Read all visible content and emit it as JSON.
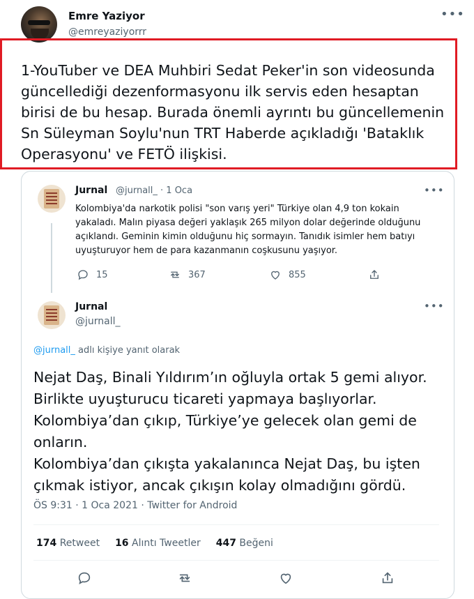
{
  "author": {
    "name": "Emre Yaziyor",
    "handle": "@emreyaziyorrr"
  },
  "tweet_text": "1-YouTuber ve DEA Muhbiri Sedat Peker'in son videosunda güncellediği dezenformasyonu ilk servis eden hesaptan birisi de bu hesap. Burada önemli ayrıntı bu güncellemenin Sn Süleyman Soylu'nun TRT Haberde açıkladığı 'Bataklık Operasyonu' ve FETÖ ilişkisi.",
  "quote_first": {
    "name": "Jurnal",
    "meta": "@jurnall_ · 1 Oca",
    "text": "Kolombiya'da narkotik polisi \"son varış yeri\" Türkiye olan 4,9 ton kokain yakaladı. Malın piyasa değeri yaklaşık 265 milyon dolar değerinde olduğunu açıklandı. Geminin kimin olduğunu hiç sormayın. Tanıdık isimler hem batıyı uyuşturuyor hem de para kazanmanın coşkusunu yaşıyor.",
    "replies": "15",
    "retweets": "367",
    "likes": "855"
  },
  "quote_second": {
    "name": "Jurnal",
    "handle": "@jurnall_",
    "reply_mention": "@jurnall_",
    "reply_suffix": "adlı kişiye yanıt olarak",
    "text_lines": [
      "Nejat Daş, Binali Yıldırım’ın oğluyla ortak 5 gemi alıyor.",
      "Birlikte uyuşturucu ticareti yapmaya başlıyorlar.",
      "Kolombiya’dan çıkıp, Türkiye’ye gelecek olan gemi de onların.",
      "Kolombiya’dan çıkışta yakalanınca Nejat Daş, bu işten çıkmak istiyor, ancak çıkışın kolay olmadığını gördü."
    ],
    "timestamp": "ÖS 9:31 · 1 Oca 2021 · Twitter for Android",
    "stats": {
      "retweet_count": "174",
      "retweet_label": "Retweet",
      "quote_count": "16",
      "quote_label": "Alıntı Tweetler",
      "like_count": "447",
      "like_label": "Beğeni"
    }
  },
  "icons": {
    "more": "more-horizontal-icon",
    "reply": "reply-icon",
    "retweet": "retweet-icon",
    "like": "heart-icon",
    "share": "share-icon"
  },
  "colors": {
    "highlight": "#e01b24",
    "link": "#1d9bf0",
    "muted": "#536471"
  }
}
